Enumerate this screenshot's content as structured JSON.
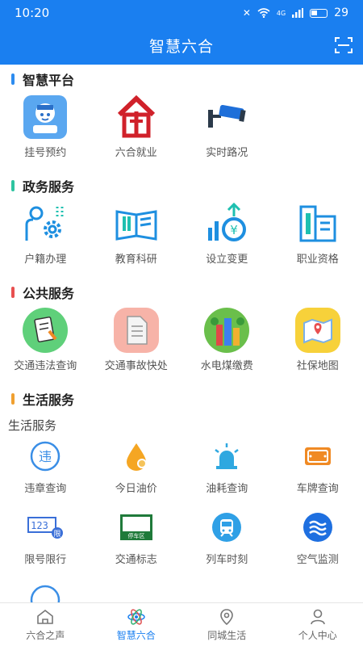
{
  "status": {
    "time": "10:20",
    "battery": "29",
    "signal": "4G"
  },
  "header": {
    "title": "智慧六合"
  },
  "sections": [
    {
      "title": "智慧平台",
      "color": "#2d8cf0",
      "items": [
        {
          "label": "挂号预约",
          "icon": "doctor-icon"
        },
        {
          "label": "六合就业",
          "icon": "employment-icon"
        },
        {
          "label": "实时路况",
          "icon": "camera-icon"
        }
      ]
    },
    {
      "title": "政务服务",
      "color": "#2ec4a0",
      "items": [
        {
          "label": "户籍办理",
          "icon": "person-gear-icon"
        },
        {
          "label": "教育科研",
          "icon": "book-icon"
        },
        {
          "label": "设立变更",
          "icon": "yuan-chart-icon"
        },
        {
          "label": "职业资格",
          "icon": "building-icon"
        }
      ]
    },
    {
      "title": "公共服务",
      "color": "#e85050",
      "items": [
        {
          "label": "交通违法查询",
          "icon": "clipboard-icon"
        },
        {
          "label": "交通事故快处",
          "icon": "document-icon"
        },
        {
          "label": "水电煤缴费",
          "icon": "city-icon"
        },
        {
          "label": "社保地图",
          "icon": "map-icon"
        }
      ]
    },
    {
      "title": "生活服务",
      "color": "#f0a030",
      "sub_label": "生活服务",
      "rows": [
        [
          {
            "label": "违章查询",
            "icon": "violation-icon"
          },
          {
            "label": "今日油价",
            "icon": "oil-drop-icon"
          },
          {
            "label": "油耗查询",
            "icon": "alarm-light-icon"
          },
          {
            "label": "车牌查询",
            "icon": "license-plate-icon"
          }
        ],
        [
          {
            "label": "限号限行",
            "icon": "restriction-icon"
          },
          {
            "label": "交通标志",
            "icon": "parking-sign-icon"
          },
          {
            "label": "列车时刻",
            "icon": "train-icon"
          },
          {
            "label": "空气监测",
            "icon": "air-icon"
          }
        ]
      ]
    }
  ],
  "icon_text": {
    "violation": "违",
    "restriction_num": "123",
    "restriction_tag": "限",
    "parking": "停车区"
  },
  "tabs": [
    {
      "label": "六合之声",
      "icon": "home-icon",
      "active": false
    },
    {
      "label": "智慧六合",
      "icon": "atom-icon",
      "active": true
    },
    {
      "label": "同城生活",
      "icon": "location-icon",
      "active": false
    },
    {
      "label": "个人中心",
      "icon": "user-icon",
      "active": false
    }
  ]
}
